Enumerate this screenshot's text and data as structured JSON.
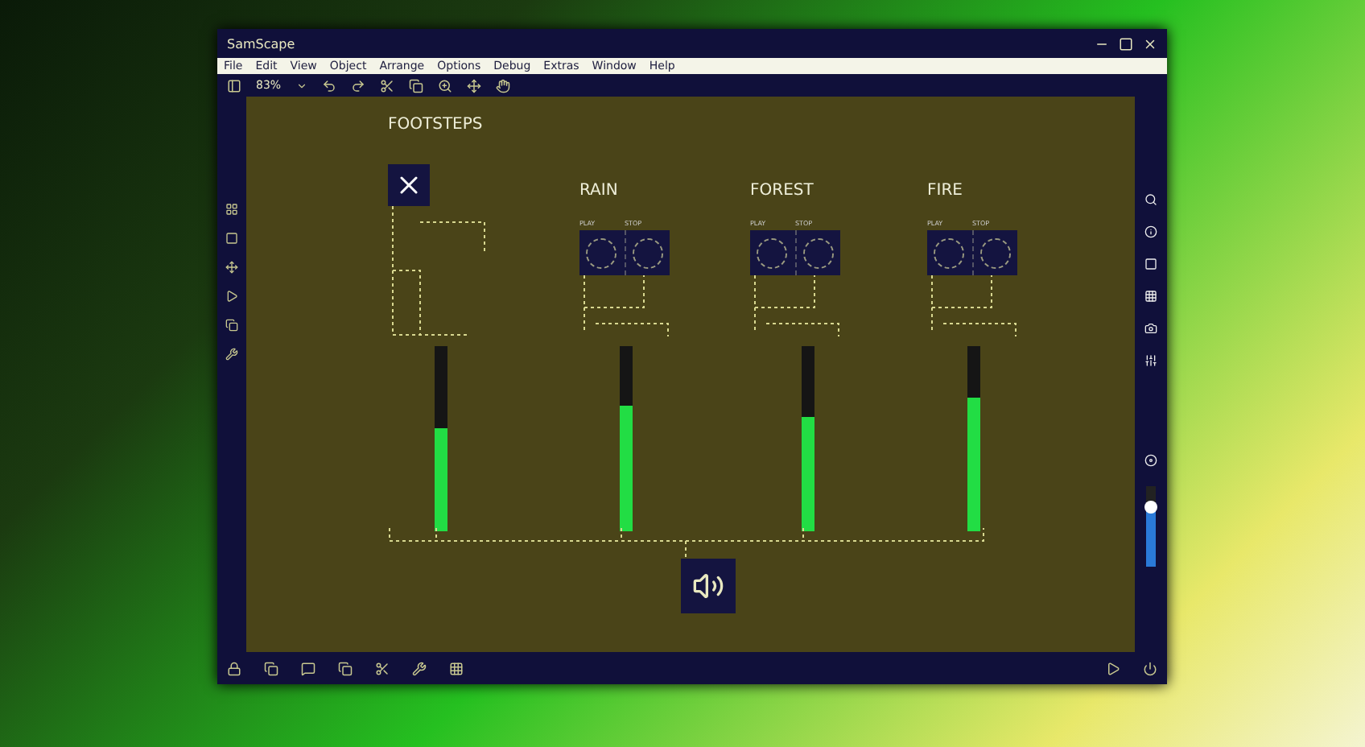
{
  "window": {
    "title": "SamScape"
  },
  "menu": [
    "File",
    "Edit",
    "View",
    "Object",
    "Arrange",
    "Options",
    "Debug",
    "Extras",
    "Window",
    "Help"
  ],
  "toolbar": {
    "zoom": "83%"
  },
  "patches": [
    {
      "kind": "toggle",
      "title": "FOOTSTEPS",
      "level": 0.56
    },
    {
      "kind": "player",
      "title": "RAIN",
      "buttons": [
        "PLAY",
        "STOP"
      ],
      "level": 0.68
    },
    {
      "kind": "player",
      "title": "FOREST",
      "buttons": [
        "PLAY",
        "STOP"
      ],
      "level": 0.62
    },
    {
      "kind": "player",
      "title": "FIRE",
      "buttons": [
        "PLAY",
        "STOP"
      ],
      "level": 0.72
    }
  ],
  "output_slider": {
    "level": 0.75
  }
}
